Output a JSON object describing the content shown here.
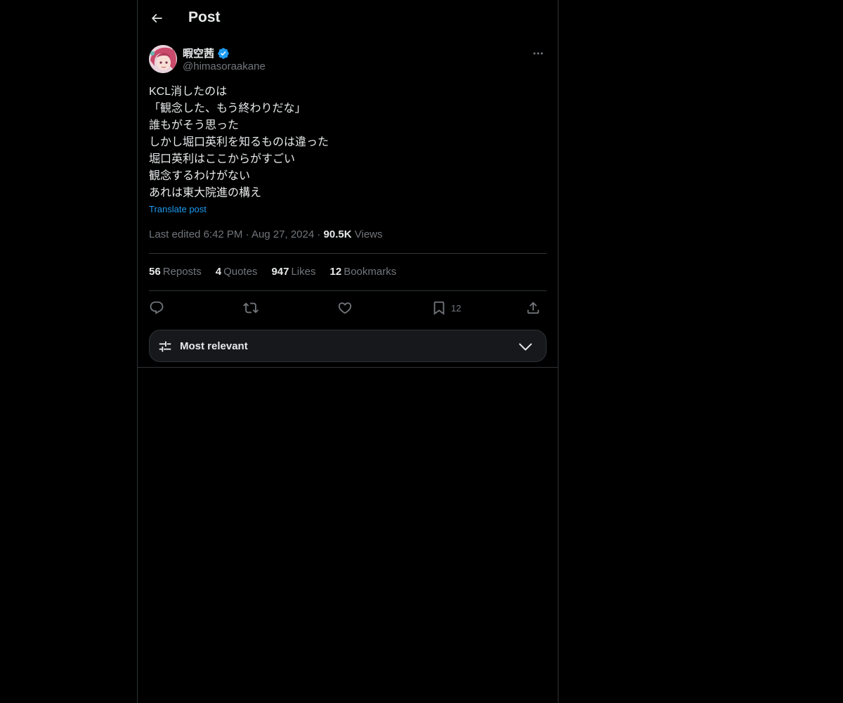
{
  "header": {
    "title": "Post",
    "back_icon": "arrow-left-icon"
  },
  "author": {
    "display_name": "暇空茜",
    "verified": true,
    "verified_color": "#1d9bf0",
    "handle": "@himasoraakane"
  },
  "post": {
    "lines": [
      "KCL消したのは",
      "「観念した、もう終わりだな」",
      "誰もがそう思った",
      "しかし堀口英利を知るものは違った",
      "堀口英利はここからがすごい",
      "観念するわけがない",
      "あれは東大院進の構え"
    ],
    "translate_label": "Translate post",
    "edited_label": "Last edited",
    "time": "6:42 PM",
    "date": "Aug 27, 2024",
    "separator": "·",
    "views_count": "90.5K",
    "views_label": "Views"
  },
  "stats": {
    "reposts": {
      "count": "56",
      "label": "Reposts"
    },
    "quotes": {
      "count": "4",
      "label": "Quotes"
    },
    "likes": {
      "count": "947",
      "label": "Likes"
    },
    "bookmarks": {
      "count": "12",
      "label": "Bookmarks"
    }
  },
  "actions": {
    "reply_icon": "reply-icon",
    "repost_icon": "repost-icon",
    "like_icon": "heart-icon",
    "bookmark_icon": "bookmark-icon",
    "bookmark_count": "12",
    "share_icon": "share-icon"
  },
  "sort": {
    "label": "Most relevant",
    "icon": "sliders-icon",
    "chevron": "chevron-down-icon"
  },
  "colors": {
    "background": "#000000",
    "text": "#e7e9ea",
    "muted": "#71767b",
    "accent": "#1d9bf0",
    "border": "#2f3336"
  }
}
